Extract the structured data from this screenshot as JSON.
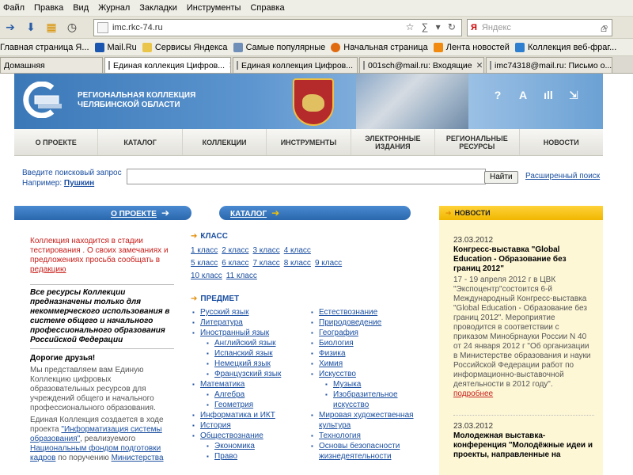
{
  "browser": {
    "menu": [
      "Файл",
      "Правка",
      "Вид",
      "Журнал",
      "Закладки",
      "Инструменты",
      "Справка"
    ],
    "url": "imc.rkc-74.ru",
    "search_placeholder": "Яндекс",
    "bookmarks": [
      "Главная страница Я...",
      "Mail.Ru",
      "Сервисы Яндекса",
      "Самые популярные",
      "Начальная страница",
      "Лента новостей",
      "Коллекция веб-фраг..."
    ],
    "tabs": [
      "Домашняя",
      "Единая коллекция Цифров...",
      "Единая коллекция Цифров...",
      "001sch@mail.ru: Входящие",
      "imc74318@mail.ru: Письмо о..."
    ]
  },
  "header": {
    "title_line1": "РЕГИОНАЛЬНАЯ КОЛЛЕКЦИЯ",
    "title_line2": "ЧЕЛЯБИНСКОЙ ОБЛАСТИ",
    "icons": [
      "?",
      "A",
      "ıll",
      "⇲"
    ]
  },
  "nav": [
    "О ПРОЕКТЕ",
    "КАТАЛОГ",
    "КОЛЛЕКЦИИ",
    "ИНСТРУМЕНТЫ",
    "ЭЛЕКТРОННЫЕ ИЗДАНИЯ",
    "РЕГИОНАЛЬНЫЕ РЕСУРСЫ",
    "НОВОСТИ"
  ],
  "search": {
    "prompt": "Введите поисковый запрос",
    "example_label": "Например:",
    "example_link": "Пушкин",
    "button": "Найти",
    "advanced": "Расширенный поиск"
  },
  "bars": {
    "about": "О ПРОЕКТЕ",
    "catalog": "КАТАЛОГ",
    "news": "НОВОСТИ"
  },
  "left": {
    "notice": "Коллекция находится в стадии тестирования . О своих замечаниях и предложениях просьба сообщать в",
    "notice_link": "редакцию",
    "disclaimer": "Все ресурсы Коллекции предназначены только для некоммерческого использования в системе общего и начального профессионального образования Российской Федерации",
    "greeting": "Дорогие друзья!",
    "intro": "Мы представляем вам Единую Коллекцию цифровых образовательных ресурсов для учреждений общего и начального профессионального образования.",
    "p2_start": "Единая Коллекция создается в ходе проекта",
    "p2_link": "\"Информатизация системы образования\"",
    "p2_mid": ", реализуемого",
    "p2_link2": "Национальным фондом подготовки кадров",
    "p2_end": "по поручению",
    "p2_link3": "Министерства"
  },
  "catalog": {
    "classes_title": "КЛАСС",
    "classes": [
      "1 класс",
      "2 класс",
      "3 класс",
      "4 класс",
      "5 класс",
      "6 класс",
      "7 класс",
      "8 класс",
      "9 класс",
      "10 класс",
      "11 класс"
    ],
    "subjects_title": "ПРЕДМЕТ",
    "col1": [
      {
        "t": "Русский язык"
      },
      {
        "t": "Литература"
      },
      {
        "t": "Иностранный язык"
      },
      {
        "t": "Английский язык",
        "sub": true
      },
      {
        "t": "Испанский язык",
        "sub": true
      },
      {
        "t": "Немецкий язык",
        "sub": true
      },
      {
        "t": "Французский язык",
        "sub": true
      },
      {
        "t": "Математика"
      },
      {
        "t": "Алгебра",
        "sub": true
      },
      {
        "t": "Геометрия",
        "sub": true
      },
      {
        "t": "Информатика и ИКТ"
      },
      {
        "t": "История"
      },
      {
        "t": "Обществознание"
      },
      {
        "t": "Экономика",
        "sub": true
      },
      {
        "t": "Право",
        "sub": true
      }
    ],
    "col2": [
      {
        "t": "Естествознание"
      },
      {
        "t": "Природоведение"
      },
      {
        "t": "География"
      },
      {
        "t": "Биология"
      },
      {
        "t": "Физика"
      },
      {
        "t": "Химия"
      },
      {
        "t": "Искусство"
      },
      {
        "t": "Музыка",
        "sub": true
      },
      {
        "t": "Изобразительное искусство",
        "sub": true
      },
      {
        "t": "Мировая художественная культура"
      },
      {
        "t": "Технология"
      },
      {
        "t": "Основы безопасности жизнедеятельности"
      }
    ]
  },
  "news": [
    {
      "date": "23.03.2012",
      "title": "Конгресс-выставка \"Global Education - Образование без границ 2012\"",
      "body": "17 - 19 апреля 2012 г в ЦВК \"Экспоцентр\"состоится 6-й Международный Конгресс-выставка \"Global Education - Образование без границ 2012\". Мероприятие проводится в соответствии с приказом Минобрнауки России N 40 от 24 января 2012 г \"Об организации в Министерстве образования и науки Российской Федерации работ по информационно-выставочной деятельности в 2012 году\".",
      "more": "подробнее"
    },
    {
      "date": "23.03.2012",
      "title": "Молодежная выставка-конференция \"Молодёжные идеи и проекты, направленные на"
    }
  ]
}
